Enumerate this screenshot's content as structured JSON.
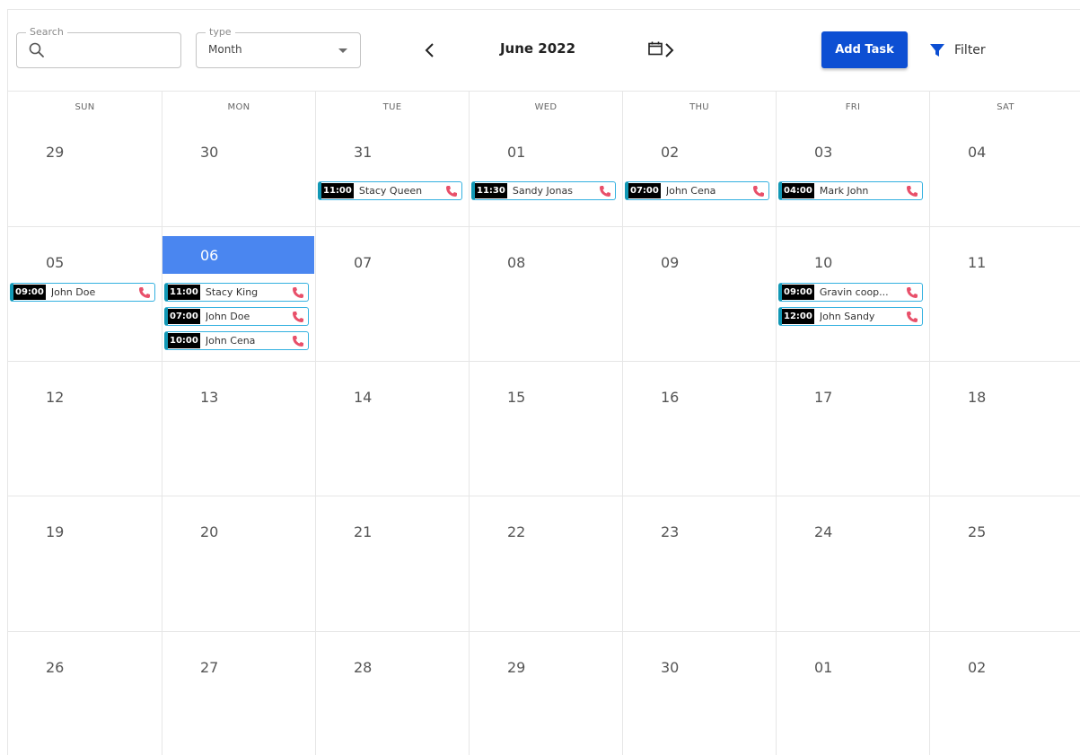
{
  "toolbar": {
    "search_legend": "Search",
    "search_value": "",
    "type_legend": "type",
    "type_value": "Month",
    "month_title": "June 2022",
    "add_task_label": "Add Task",
    "filter_label": "Filter"
  },
  "calendar": {
    "days_of_week": [
      "SUN",
      "MON",
      "TUE",
      "WED",
      "THU",
      "FRI",
      "SAT"
    ],
    "weeks": [
      [
        "29",
        "30",
        "31",
        "01",
        "02",
        "03",
        "04"
      ],
      [
        "05",
        "06",
        "07",
        "08",
        "09",
        "10",
        "11"
      ],
      [
        "12",
        "13",
        "14",
        "15",
        "16",
        "17",
        "18"
      ],
      [
        "19",
        "20",
        "21",
        "22",
        "23",
        "24",
        "25"
      ],
      [
        "26",
        "27",
        "28",
        "29",
        "30",
        "01",
        "02"
      ]
    ],
    "today": "06"
  },
  "events": [
    {
      "time": "11:00",
      "name": "Stacy Queen"
    },
    {
      "time": "11:30",
      "name": "Sandy Jonas"
    },
    {
      "time": "07:00",
      "name": "John Cena"
    },
    {
      "time": "04:00",
      "name": "Mark John"
    },
    {
      "time": "09:00",
      "name": "John Doe"
    },
    {
      "time": "11:00",
      "name": "Stacy King"
    },
    {
      "time": "07:00",
      "name": "John Doe"
    },
    {
      "time": "10:00",
      "name": "John Cena"
    },
    {
      "time": "09:00",
      "name": "Gravin coop..."
    },
    {
      "time": "12:00",
      "name": "John Sandy"
    }
  ],
  "colors": {
    "accent": "#0d4fd3",
    "today_bg": "#4a86f0",
    "event_border": "#34b1e0",
    "event_stripe": "#1298b5",
    "phone_icon": "#e8506a"
  },
  "icons": {
    "search": "search-icon",
    "dropdown": "caret-down-icon",
    "prev": "chevron-left-icon",
    "next": "chevron-right-icon",
    "calendar": "calendar-icon",
    "filter": "filter-icon",
    "event_call": "phone-icon"
  }
}
